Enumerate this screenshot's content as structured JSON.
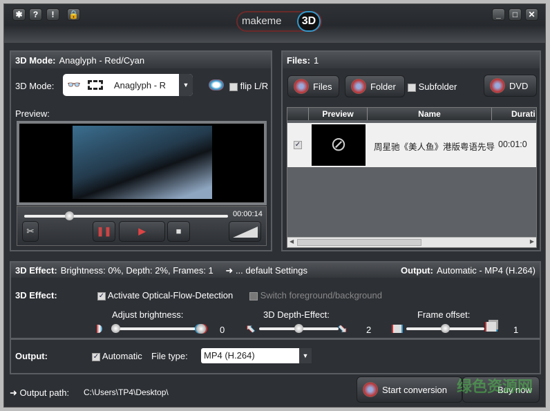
{
  "toolbar": {
    "icons": [
      "gear-icon",
      "help-icon",
      "info-icon",
      "lock-icon"
    ],
    "help": "?",
    "info": "!"
  },
  "logo": {
    "text": "makeme",
    "badge": "3D"
  },
  "window_controls": {
    "minimize": "_",
    "maximize": "□",
    "close": "✕"
  },
  "mode_panel": {
    "header_label": "3D Mode:",
    "header_value": "Anaglyph - Red/Cyan",
    "mode_label": "3D Mode:",
    "mode_value": "Anaglyph - R",
    "flip_label": "flip L/R",
    "flip_checked": false,
    "preview_label": "Preview:",
    "time": "00:00:14",
    "progress": 0.22
  },
  "files_panel": {
    "header_label": "Files:",
    "header_value": "1",
    "files_button": "Files",
    "folder_button": "Folder",
    "subfolder_label": "Subfolder",
    "subfolder_checked": false,
    "dvd_button": "DVD",
    "columns": [
      "Preview",
      "Name",
      "Durati"
    ],
    "rows": [
      {
        "checked": true,
        "name": "周星驰《美人鱼》港版粤语先导",
        "duration": "00:01:0"
      }
    ]
  },
  "effect_panel": {
    "header_label": "3D Effect:",
    "header_value": "Brightness: 0%, Depth: 2%, Frames: 1",
    "default_settings": "... default Settings",
    "output_label": "Output:",
    "output_value": "Automatic - MP4 (H.264)",
    "effect_label": "3D Effect:",
    "optical_flow": "Activate Optical-Flow-Detection",
    "optical_flow_checked": true,
    "switch_fg_bg": "Switch foreground/background",
    "switch_checked": false,
    "brightness_label": "Adjust brightness:",
    "brightness_value": "0",
    "depth_label": "3D Depth-Effect:",
    "depth_value": "2",
    "frame_label": "Frame offset:",
    "frame_value": "1",
    "out_label": "Output:",
    "automatic_label": "Automatic",
    "automatic_checked": true,
    "filetype_label": "File type:",
    "filetype_value": "MP4 (H.264)"
  },
  "footer": {
    "output_path_label": "Output path:",
    "output_path": "C:\\Users\\TP4\\Desktop\\",
    "start_button": "Start conversion",
    "buy_button": "Buy now"
  },
  "watermark": "绿色资源网 www.downcc.com"
}
